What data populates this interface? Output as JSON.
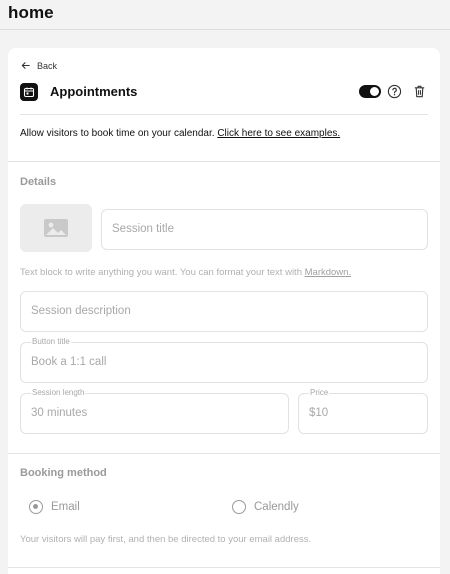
{
  "header": {
    "title": "home"
  },
  "card": {
    "back_label": "Back",
    "title": "Appointments",
    "enabled": true,
    "intro_text": "Allow visitors to book time on your calendar. ",
    "intro_link": "Click here to see examples."
  },
  "details": {
    "section_title": "Details",
    "image_icon": "image-icon",
    "session_title_placeholder": "Session title",
    "hint_text": "Text block to write anything you want. You can format your text with ",
    "hint_link": "Markdown.",
    "session_description_placeholder": "Session description",
    "button_title_label": "Button title",
    "button_title_placeholder": "Book a 1:1 call",
    "session_length_label": "Session length",
    "session_length_value": "30 minutes",
    "price_label": "Price",
    "price_value": "$10"
  },
  "booking": {
    "section_title": "Booking method",
    "options": [
      {
        "label": "Email",
        "selected": true
      },
      {
        "label": "Calendly",
        "selected": false
      }
    ],
    "note": "Your visitors will pay first, and then be directed to your email address."
  },
  "colors": {
    "accent": "#111111",
    "muted": "#9a9a9a",
    "border": "#e2e2e2"
  }
}
